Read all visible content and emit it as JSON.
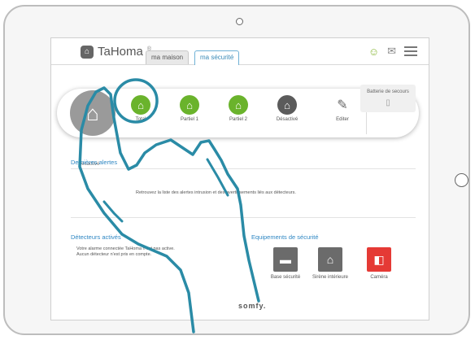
{
  "app": {
    "logo": "TaHoma",
    "logo_mark": "®"
  },
  "tabs": [
    {
      "label": "ma maison",
      "active": false
    },
    {
      "label": "ma sécurité",
      "active": true
    }
  ],
  "header_icons": [
    "user-icon",
    "mail-icon",
    "menu-icon"
  ],
  "current_mode": {
    "label": "Désactivé"
  },
  "modes": [
    {
      "label": "Total",
      "color": "#6ab32c"
    },
    {
      "label": "Partiel 1",
      "color": "#6ab32c"
    },
    {
      "label": "Partiel 2",
      "color": "#6ab32c"
    },
    {
      "label": "Désactivé",
      "color": "#5b5b5b"
    },
    {
      "label": "Editer"
    }
  ],
  "battery": {
    "label": "Batterie de secours"
  },
  "alerts": {
    "title": "Dernières alertes",
    "message": "Retrouvez la liste des alertes intrusion et des avertissements liés aux détecteurs."
  },
  "detectors": {
    "title": "Détecteurs activés",
    "line1": "Votre alarme connectée TaHoma n'est pas active.",
    "line2": "Aucun détecteur n'est pris en compte."
  },
  "equipment": {
    "title": "Equipements de sécurité",
    "items": [
      {
        "label": "Base sécurité",
        "color": "#6b6b6b"
      },
      {
        "label": "Sirène intérieure",
        "color": "#6b6b6b"
      },
      {
        "label": "Caméra",
        "color": "#e53a35"
      }
    ]
  },
  "footer": {
    "brand": "somfy."
  },
  "colors": {
    "accent_blue": "#2f87c3",
    "green": "#6ab32c",
    "hand_outline": "#2a8ba6"
  }
}
